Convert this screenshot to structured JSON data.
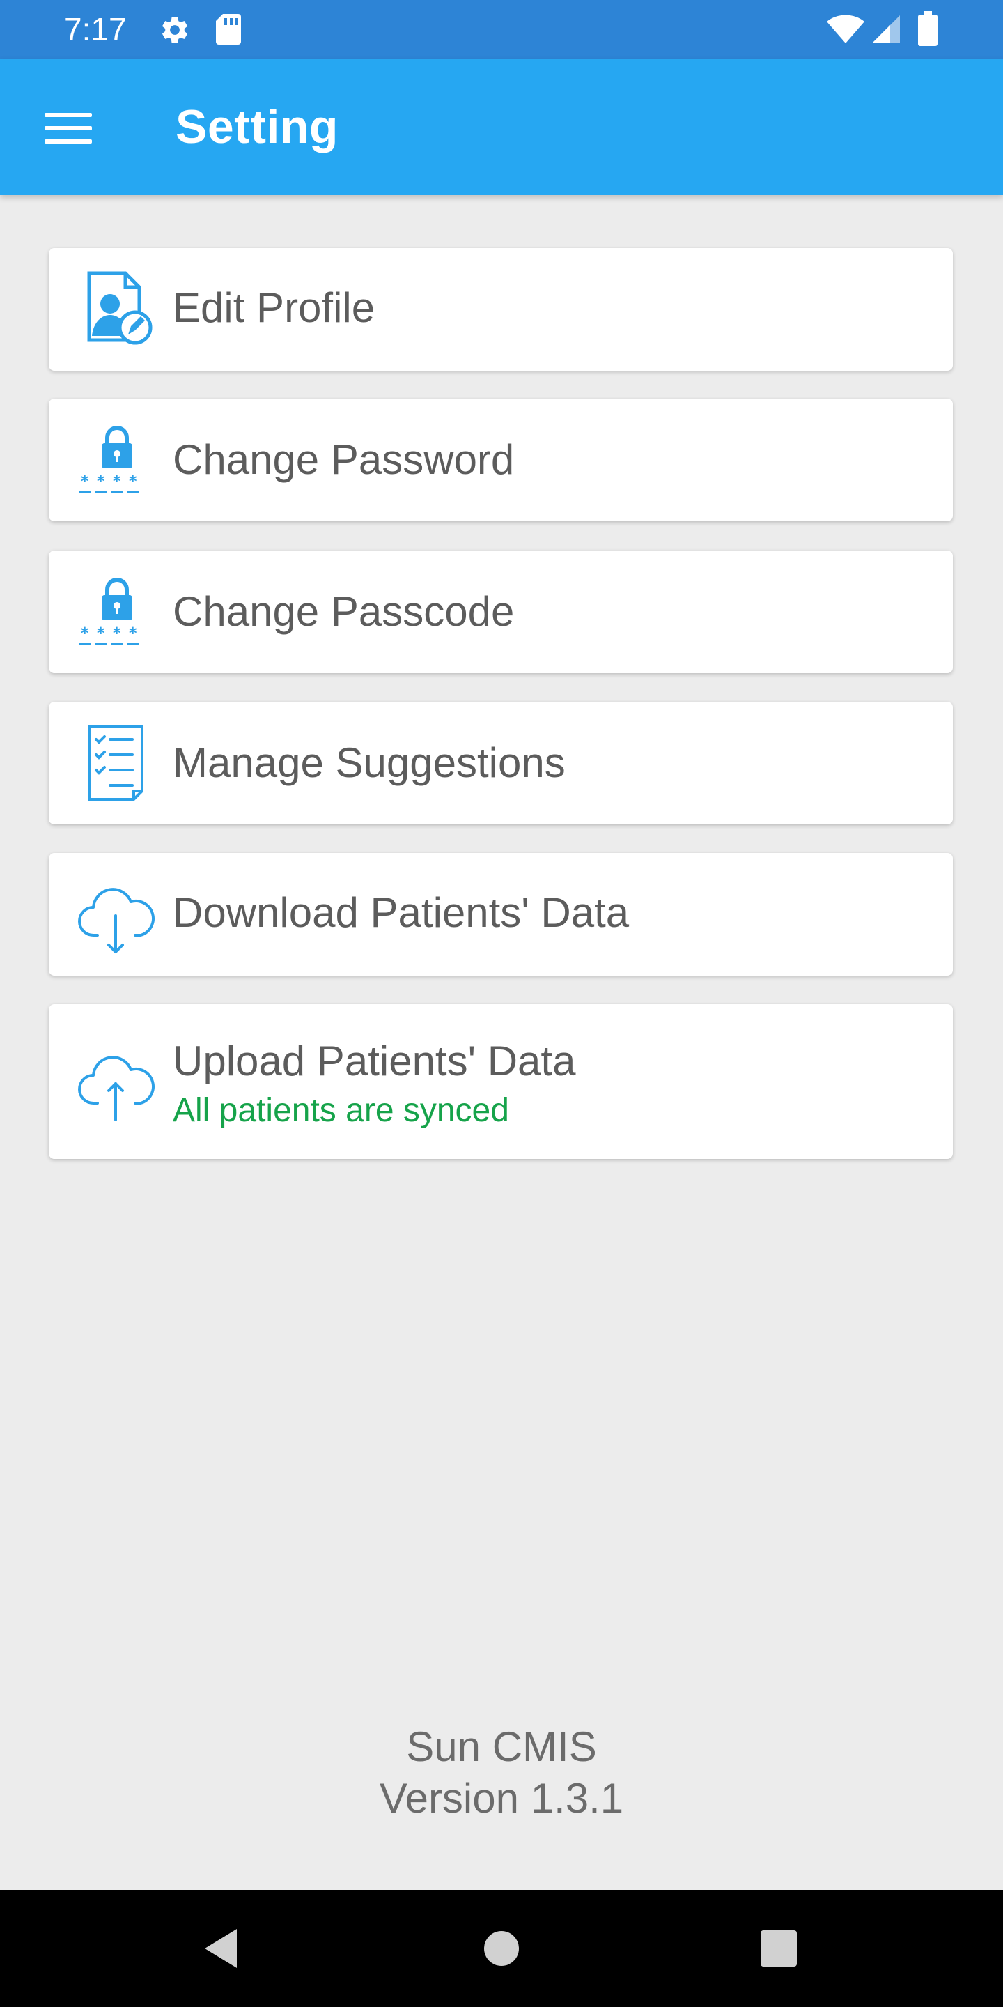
{
  "status_bar": {
    "time": "7:17",
    "left_icons": [
      "gear-icon",
      "sd-card-icon"
    ],
    "right_icons": [
      "wifi-icon",
      "cell-signal-icon",
      "battery-icon"
    ],
    "color": "#2D84D6"
  },
  "app_bar": {
    "title": "Setting",
    "menu_icon": "hamburger-menu-icon",
    "color": "#26A7F2"
  },
  "settings": {
    "items": [
      {
        "label": "Edit Profile",
        "icon": "edit-profile-icon"
      },
      {
        "label": "Change Password",
        "icon": "lock-password-icon"
      },
      {
        "label": "Change Passcode",
        "icon": "lock-passcode-icon"
      },
      {
        "label": "Manage Suggestions",
        "icon": "checklist-icon"
      },
      {
        "label": "Download Patients' Data",
        "icon": "cloud-download-icon"
      },
      {
        "label": "Upload Patients' Data",
        "icon": "cloud-upload-icon",
        "subtitle": "All patients are synced"
      }
    ]
  },
  "footer": {
    "app_name": "Sun CMIS",
    "version": "Version 1.3.1"
  },
  "nav_bar": {
    "buttons": [
      "back-icon",
      "home-icon",
      "recents-icon"
    ]
  },
  "colors": {
    "accent": "#26A7F2",
    "icon_blue": "#2DA1E8",
    "synced_green": "#16A34A",
    "text_gray": "#5C5C5C",
    "background": "#ECECEC"
  }
}
